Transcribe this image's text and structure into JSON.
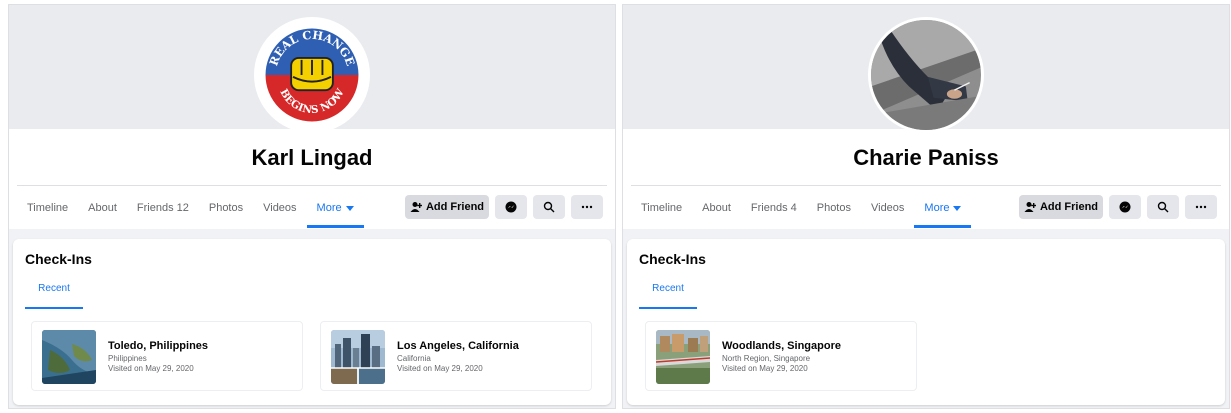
{
  "profiles": [
    {
      "name": "Karl Lingad",
      "avatar_icon": "real-change-begins-now-logo",
      "avatar_text_top": "REAL CHANGE",
      "avatar_text_bottom": "BEGINS NOW",
      "tabs": [
        {
          "label": "Timeline",
          "count": ""
        },
        {
          "label": "About",
          "count": ""
        },
        {
          "label": "Friends",
          "count": "12"
        },
        {
          "label": "Photos",
          "count": ""
        },
        {
          "label": "Videos",
          "count": ""
        },
        {
          "label": "More",
          "count": "",
          "active": true
        }
      ],
      "add_friend_label": "Add Friend",
      "checkins_title": "Check-Ins",
      "recent_tab": "Recent",
      "checkins": [
        {
          "title": "Toledo, Philippines",
          "region": "Philippines",
          "visited": "Visited on May 29, 2020",
          "thumb": "aerial-coast-photo"
        },
        {
          "title": "Los Angeles, California",
          "region": "California",
          "visited": "Visited on May 29, 2020",
          "thumb": "city-collage-photo"
        }
      ]
    },
    {
      "name": "Charie Paniss",
      "avatar_icon": "person-sitting-photo",
      "tabs": [
        {
          "label": "Timeline",
          "count": ""
        },
        {
          "label": "About",
          "count": ""
        },
        {
          "label": "Friends",
          "count": "4"
        },
        {
          "label": "Photos",
          "count": ""
        },
        {
          "label": "Videos",
          "count": ""
        },
        {
          "label": "More",
          "count": "",
          "active": true
        }
      ],
      "add_friend_label": "Add Friend",
      "checkins_title": "Check-Ins",
      "recent_tab": "Recent",
      "checkins": [
        {
          "title": "Woodlands, Singapore",
          "region": "North Region, Singapore",
          "visited": "Visited on May 29, 2020",
          "thumb": "train-city-photo"
        }
      ]
    }
  ],
  "colors": {
    "accent": "#1877f2",
    "secondary_text": "#65676b",
    "button_bg": "#e4e6eb",
    "page_bg": "#f0f2f5"
  }
}
